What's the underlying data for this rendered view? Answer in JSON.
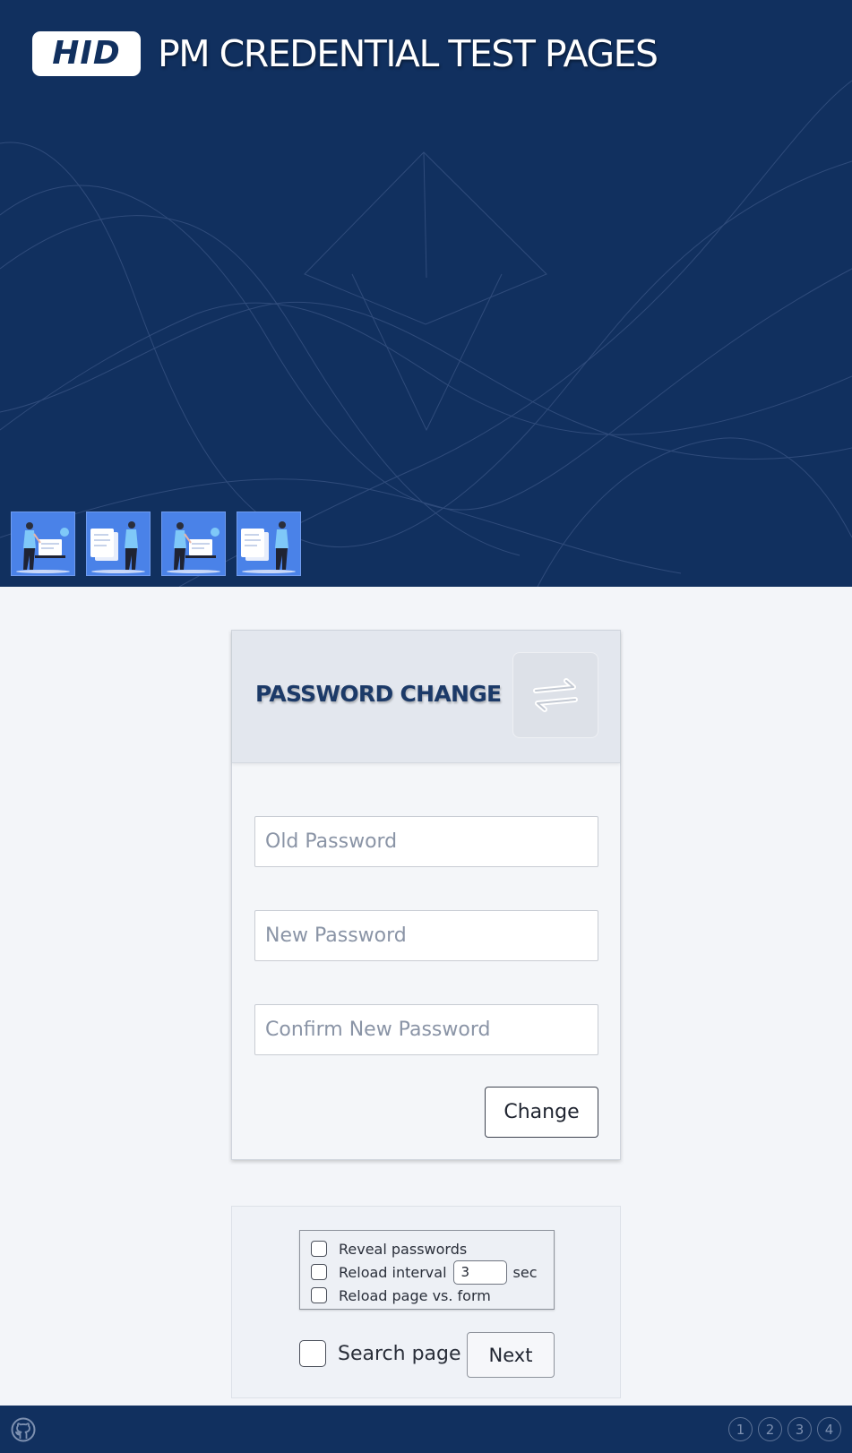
{
  "header": {
    "logo_text": "HID",
    "title": "PM CREDENTIAL TEST PAGES",
    "thumbnails": [
      {
        "name": "thumb-login-1",
        "icon": "person-laptop-icon"
      },
      {
        "name": "thumb-docs-1",
        "icon": "person-documents-icon"
      },
      {
        "name": "thumb-login-2",
        "icon": "person-laptop-icon"
      },
      {
        "name": "thumb-docs-2",
        "icon": "person-documents-icon"
      }
    ]
  },
  "card": {
    "title": "PASSWORD CHANGE",
    "icon": "swap-arrows-icon",
    "fields": {
      "old_placeholder": "Old Password",
      "new_placeholder": "New Password",
      "confirm_placeholder": "Confirm New Password"
    },
    "submit_label": "Change"
  },
  "options": {
    "reveal_label": "Reveal passwords",
    "reload_interval_label": "Reload interval",
    "reload_interval_value": "3",
    "reload_interval_unit": "sec",
    "reload_page_label": "Reload page vs. form",
    "search_label": "Search page",
    "next_label": "Next"
  },
  "footer": {
    "github_icon": "github-icon",
    "pages": [
      "1",
      "2",
      "3",
      "4"
    ]
  },
  "colors": {
    "header_bg": "#11305f",
    "thumb_bg": "#4a82e8",
    "card_head_bg": "#e3e7ee",
    "title_color": "#1c3a68",
    "page_bg": "#f3f5f9"
  }
}
